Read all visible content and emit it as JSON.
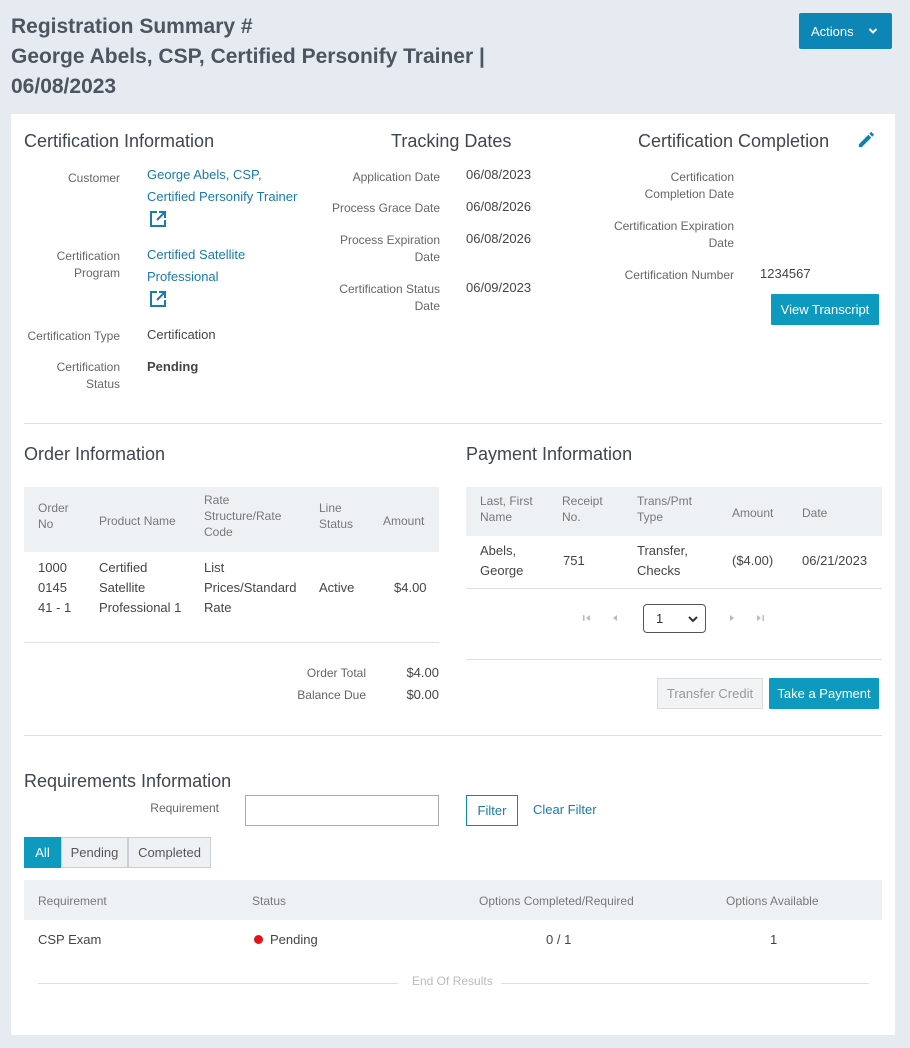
{
  "header": {
    "title_line1": "Registration Summary #",
    "title_line2": "George Abels, CSP, Certified Personify Trainer |",
    "title_line3": "06/08/2023",
    "actions_label": "Actions"
  },
  "certification_info": {
    "heading": "Certification Information",
    "customer_label": "Customer",
    "customer_value_line1": "George Abels, CSP,",
    "customer_value_line2": "Certified Personify Trainer",
    "program_label_line1": "Certification",
    "program_label_line2": "Program",
    "program_value_line1": "Certified Satellite",
    "program_value_line2": "Professional",
    "type_label": "Certification Type",
    "type_value": "Certification",
    "status_label_line1": "Certification",
    "status_label_line2": "Status",
    "status_value": "Pending"
  },
  "tracking_dates": {
    "heading": "Tracking Dates",
    "application_label": "Application Date",
    "application_value": "06/08/2023",
    "grace_label": "Process Grace Date",
    "grace_value": "06/08/2026",
    "expiration_label_line1": "Process Expiration",
    "expiration_label_line2": "Date",
    "expiration_value": "06/08/2026",
    "status_label_line1": "Certification Status",
    "status_label_line2": "Date",
    "status_value": "06/09/2023"
  },
  "certification_completion": {
    "heading": "Certification Completion",
    "completion_label_line1": "Certification",
    "completion_label_line2": "Completion Date",
    "expiration_label_line1": "Certification Expiration",
    "expiration_label_line2": "Date",
    "number_label": "Certification Number",
    "number_value": "1234567",
    "view_transcript_label": "View Transcript"
  },
  "order_info": {
    "heading": "Order Information",
    "columns": {
      "order_no_1": "Order",
      "order_no_2": "No",
      "product": "Product Name",
      "rate_1": "Rate",
      "rate_2": "Structure/Rate",
      "rate_3": "Code",
      "line_1": "Line",
      "line_2": "Status",
      "amount": "Amount"
    },
    "row": {
      "order_no_1": "1000",
      "order_no_2": "0145",
      "order_no_3": "41 - 1",
      "product_1": "Certified",
      "product_2": "Satellite",
      "product_3": "Professional 1",
      "rate_1": "List",
      "rate_2": "Prices/Standard",
      "rate_3": "Rate",
      "status": "Active",
      "amount": "$4.00"
    },
    "order_total_label": "Order Total",
    "order_total_value": "$4.00",
    "balance_due_label": "Balance Due",
    "balance_due_value": "$0.00"
  },
  "payment_info": {
    "heading": "Payment Information",
    "columns": {
      "name_1": "Last, First",
      "name_2": "Name",
      "receipt_1": "Receipt",
      "receipt_2": "No.",
      "trans_1": "Trans/Pmt",
      "trans_2": "Type",
      "amount": "Amount",
      "date": "Date"
    },
    "row": {
      "name_1": "Abels,",
      "name_2": "George",
      "receipt": "751",
      "trans_1": "Transfer,",
      "trans_2": "Checks",
      "amount": "($4.00)",
      "date": "06/21/2023"
    },
    "pager_value": "1",
    "transfer_credit_label": "Transfer Credit",
    "take_payment_label": "Take a Payment"
  },
  "requirements": {
    "heading": "Requirements Information",
    "filter_label": "Requirement",
    "filter_value": "",
    "filter_button": "Filter",
    "clear_filter": "Clear Filter",
    "tabs": [
      "All",
      "Pending",
      "Completed"
    ],
    "columns": {
      "requirement": "Requirement",
      "status": "Status",
      "options_completed": "Options Completed/Required",
      "options_available": "Options Available"
    },
    "row": {
      "requirement": "CSP Exam",
      "status": "Pending",
      "options_completed": "0 / 1",
      "options_available": "1"
    },
    "end_of_results": "End Of Results"
  },
  "colors": {
    "accent": "#0e99bf",
    "link": "#1a7aaa",
    "status_pending": "#e3131b"
  }
}
